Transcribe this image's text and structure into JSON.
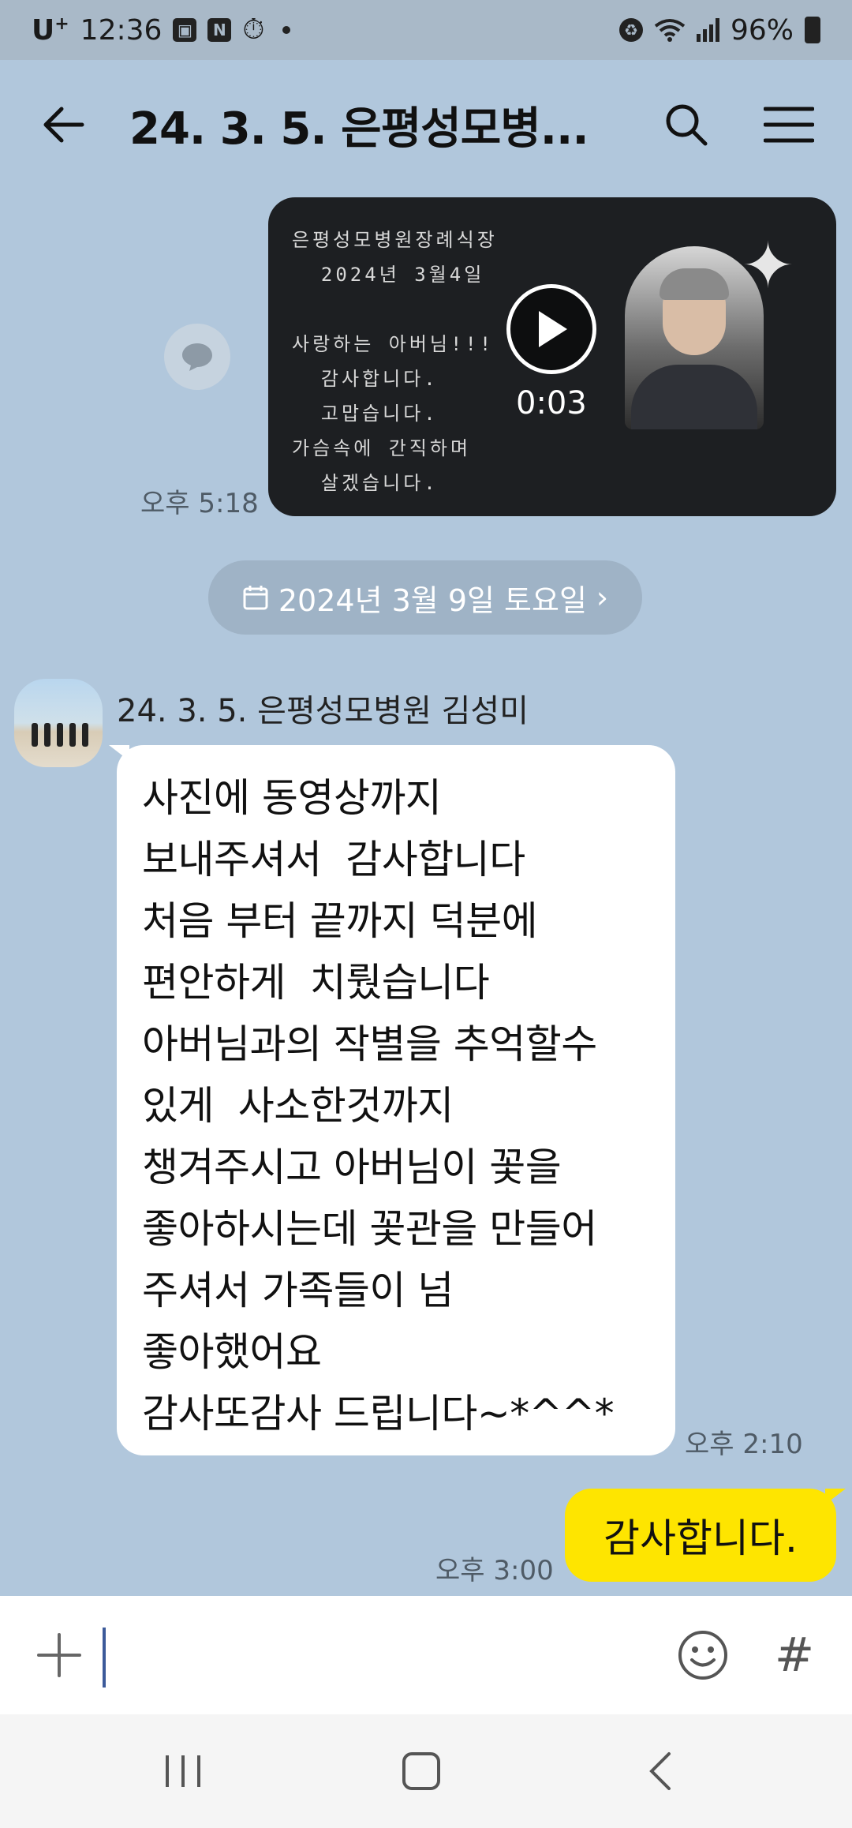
{
  "status_bar": {
    "carrier": "U",
    "carrier_sup": "+",
    "time": "12:36",
    "battery": "96%",
    "icons": [
      "gallery-icon",
      "n-icon",
      "timer-icon",
      "dot-icon",
      "battery-saver-icon",
      "wifi-icon",
      "signal-icon",
      "battery-icon"
    ]
  },
  "header": {
    "title": "24. 3. 5. 은평성모병...",
    "icons": [
      "back-arrow-icon",
      "search-icon",
      "menu-icon"
    ]
  },
  "video_message": {
    "overlay_text": "은평성모병원장례식장\n  2024년 3월4일\n\n사랑하는 아버님!!!\n  감사합니다.\n  고맙습니다.\n가슴속에 간직하며\n  살겠습니다.",
    "duration": "0:03",
    "time": "오후 5:18"
  },
  "date_divider": {
    "label": "2024년 3월 9일 토요일",
    "chevron": "›"
  },
  "received_message": {
    "sender": "24. 3. 5. 은평성모병원 김성미",
    "lines": [
      "사진에 동영상까지",
      "보내주셔서  감사합니다",
      "처음 부터 끝까지 덕분에",
      "편안하게  치뤘습니다",
      "아버님과의 작별을 추억할수",
      "있게  사소한것까지",
      "챙겨주시고 아버님이 꽃을",
      "좋아하시는데 꽃관을 만들어",
      "주셔서 가족들이 넘",
      "좋아했어요",
      "감사또감사 드립니다~*^^*"
    ],
    "time": "오후 2:10"
  },
  "sent_message": {
    "text": "감사합니다.",
    "time": "오후 3:00"
  },
  "input_bar": {
    "value": "",
    "hash": "#"
  },
  "colors": {
    "chat_background": "#b1c7dc",
    "sent_bubble": "#fee500",
    "received_bubble": "#ffffff"
  }
}
